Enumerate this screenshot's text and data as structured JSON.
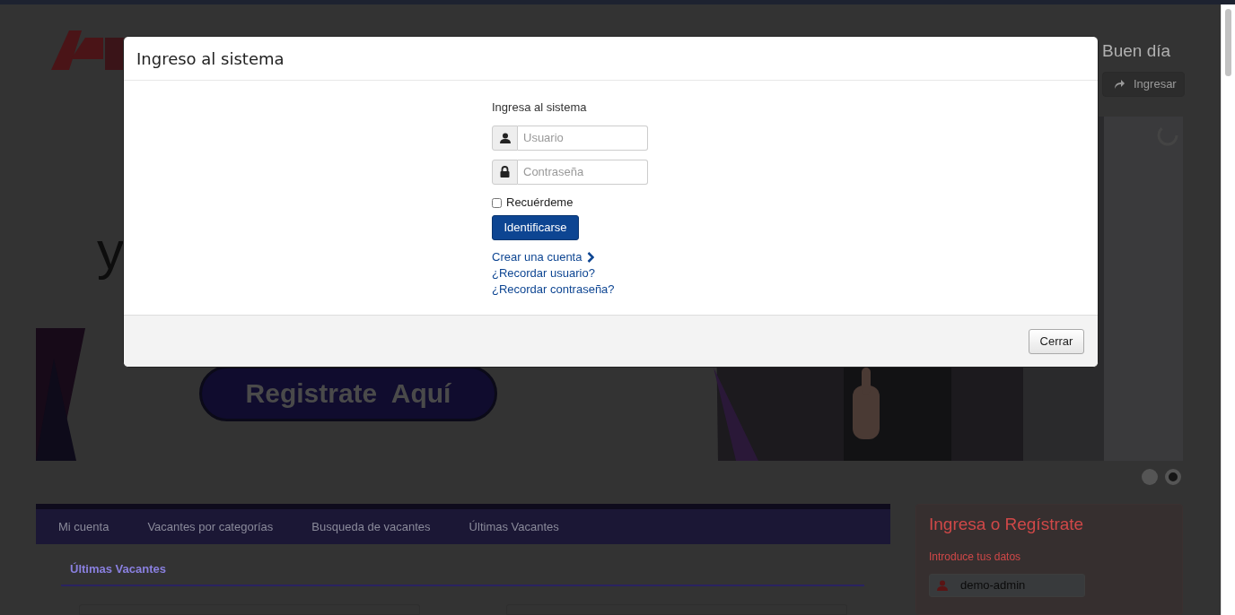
{
  "page": {
    "greeting": "Buen día",
    "login_button": "Ingresar",
    "hero": {
      "heading_fragment": "y",
      "cta": "Registrate  Aquí"
    },
    "carousel_dots": [
      {
        "selected": false
      },
      {
        "selected": true
      }
    ],
    "nav": [
      {
        "label": "Mi cuenta"
      },
      {
        "label": "Vacantes por categorías"
      },
      {
        "label": "Busqueda de vacantes"
      },
      {
        "label": "Últimas Vacantes"
      }
    ],
    "section_title": "Últimas Vacantes",
    "side_panel": {
      "title": "Ingresa o Regístrate",
      "subtitle": "Introduce tus datos",
      "username": "demo-admin"
    }
  },
  "modal": {
    "title": "Ingreso al sistema",
    "form_label": "Ingresa al sistema",
    "fields": [
      {
        "kind": "user",
        "placeholder": "Usuario"
      },
      {
        "kind": "password",
        "placeholder": "Contraseña"
      }
    ],
    "remember": {
      "label": "Recuérdeme",
      "checked": false
    },
    "submit": "Identificarse",
    "links": [
      {
        "label": "Crear una cuenta",
        "chevron": true
      },
      {
        "label": "¿Recordar usuario?",
        "chevron": false
      },
      {
        "label": "¿Recordar contraseña?",
        "chevron": false
      }
    ],
    "close": "Cerrar"
  }
}
